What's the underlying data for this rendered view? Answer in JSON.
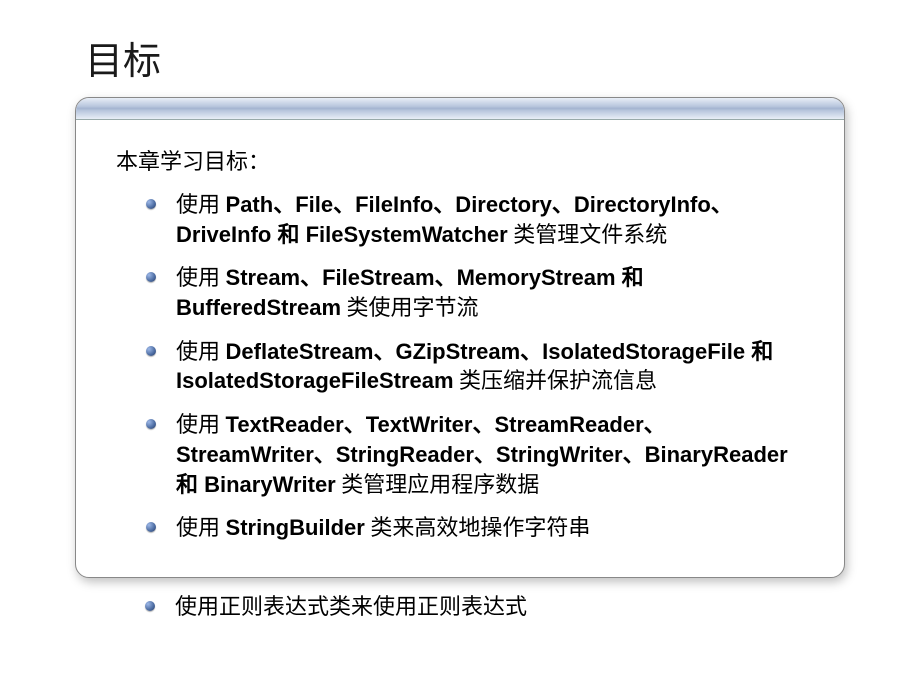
{
  "title": "目标",
  "intro": "本章学习目标：",
  "items": [
    {
      "pre": "使用 ",
      "bold": "Path、File、FileInfo、Directory、DirectoryInfo、DriveInfo 和 FileSystemWatcher",
      "post": " 类管理文件系统"
    },
    {
      "pre": "使用 ",
      "bold": "Stream、FileStream、MemoryStream 和 BufferedStream",
      "post": " 类使用字节流"
    },
    {
      "pre": "使用 ",
      "bold": "DeflateStream、GZipStream、IsolatedStorageFile 和 IsolatedStorageFileStream",
      "post": " 类压缩并保护流信息"
    },
    {
      "pre": "使用 ",
      "bold": "TextReader、TextWriter、StreamReader、StreamWriter、StringReader、StringWriter、BinaryReader 和 BinaryWriter",
      "post": " 类管理应用程序数据"
    },
    {
      "pre": "使用 ",
      "bold": "StringBuilder",
      "post": " 类来高效地操作字符串"
    }
  ],
  "outside_item": {
    "text": "使用正则表达式类来使用正则表达式"
  }
}
